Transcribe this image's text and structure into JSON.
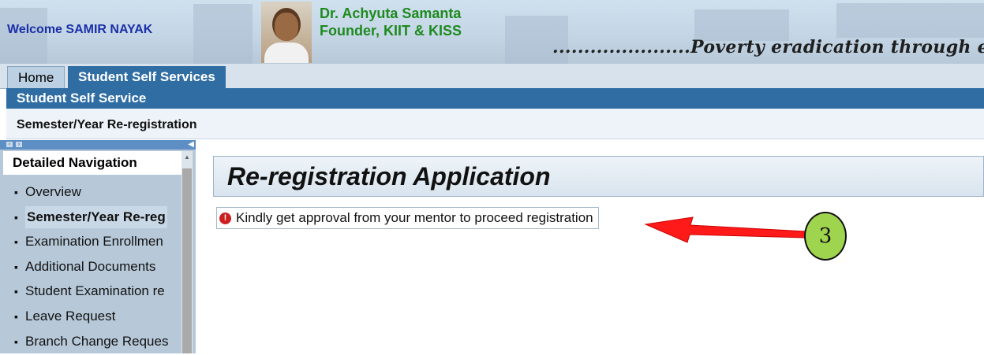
{
  "header": {
    "welcome": "Welcome SAMIR NAYAK",
    "founder_name": "Dr. Achyuta Samanta",
    "founder_title": "Founder, KIIT & KISS",
    "tagline": "......................Poverty eradication through educatio"
  },
  "tabs": {
    "home": "Home",
    "student_self_services": "Student Self Services"
  },
  "subnav": {
    "label": "Student Self Service"
  },
  "page": {
    "title": "Semester/Year Re-registration"
  },
  "sidebar": {
    "title": "Detailed Navigation",
    "items": [
      {
        "label": "Overview"
      },
      {
        "label": "Semester/Year Re-reg"
      },
      {
        "label": "Examination Enrollmen"
      },
      {
        "label": "Additional Documents"
      },
      {
        "label": "Student Examination re"
      },
      {
        "label": "Leave Request"
      },
      {
        "label": "Branch Change Reques"
      }
    ],
    "active_index": 1
  },
  "main": {
    "title": "Re-registration Application",
    "message": "Kindly get approval from your mentor to proceed registration"
  },
  "annotation": {
    "number": "3",
    "arrow_color": "#ff1a1a",
    "circle_color": "#9fd44f"
  }
}
